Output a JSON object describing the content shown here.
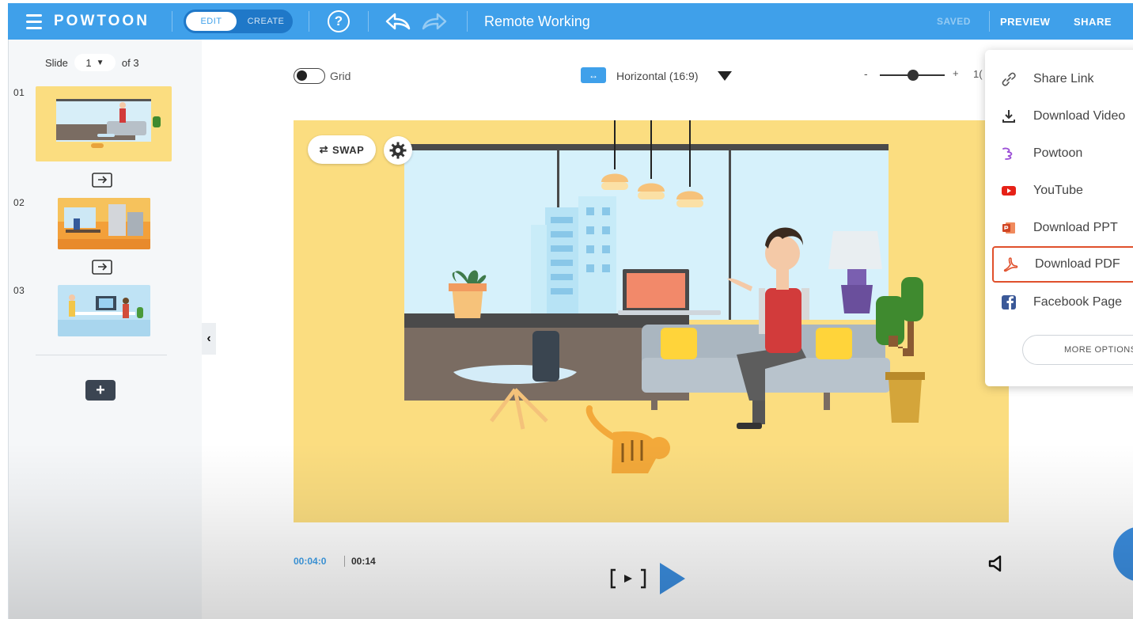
{
  "topbar": {
    "brand": "POWTOON",
    "mode_edit": "EDIT",
    "mode_create": "CREATE",
    "help_glyph": "?",
    "doc_title": "Remote Working",
    "saved": "SAVED",
    "preview": "PREVIEW",
    "share": "SHARE",
    "colors": {
      "bar": "#3fa0ea"
    }
  },
  "sidebar": {
    "slide_label": "Slide",
    "current_slide": "1",
    "of_label": "of 3",
    "slides": [
      {
        "num": "01"
      },
      {
        "num": "02"
      },
      {
        "num": "03"
      }
    ],
    "add_glyph": "+",
    "collapse_glyph": "‹"
  },
  "canvas": {
    "grid_label": "Grid",
    "orientation_label": "Horizontal (16:9)",
    "orientation_glyph": "↔",
    "zoom_minus": "-",
    "zoom_plus": "+",
    "zoom_value": "1(",
    "swap_label": "SWAP",
    "swap_glyph": "⇄"
  },
  "player": {
    "current_time": "00:04:0",
    "total_time": "00:14"
  },
  "share_menu": {
    "items": [
      {
        "label": "Share Link",
        "icon": "link-icon"
      },
      {
        "label": "Download Video",
        "icon": "download-icon"
      },
      {
        "label": "Powtoon",
        "icon": "powtoon-icon"
      },
      {
        "label": "YouTube",
        "icon": "youtube-icon"
      },
      {
        "label": "Download PPT",
        "icon": "powerpoint-icon"
      },
      {
        "label": "Download PDF",
        "icon": "pdf-icon"
      },
      {
        "label": "Facebook Page",
        "icon": "facebook-icon"
      }
    ],
    "more_options": "MORE OPTIONS",
    "highlight_color": "#e0502c"
  }
}
